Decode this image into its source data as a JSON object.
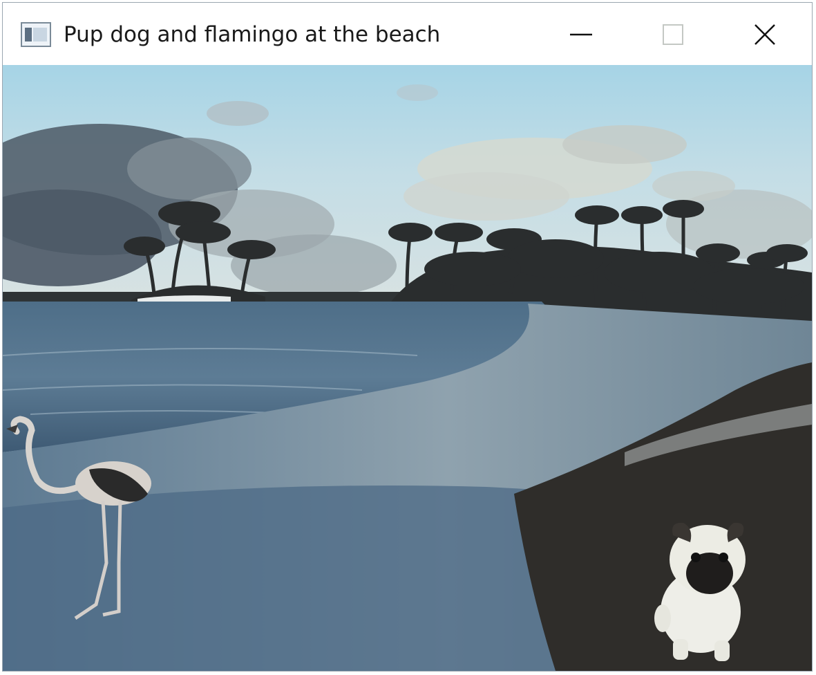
{
  "window": {
    "title": "Pup dog and flamingo at the beach"
  },
  "titlebar": {
    "app_icon": "app-window-icon",
    "controls": [
      {
        "name": "minimize",
        "icon": "minimize-icon"
      },
      {
        "name": "maximize",
        "icon": "maximize-icon"
      },
      {
        "name": "close",
        "icon": "close-icon"
      }
    ]
  },
  "scene": {
    "elements": [
      "sky",
      "clouds",
      "palm-trees",
      "ocean",
      "beach",
      "flamingo",
      "pug"
    ]
  },
  "colors": {
    "titlebar_bg": "#ffffff",
    "sky": "#a9d3e4",
    "water": "#4a6a86",
    "sand_dark": "#2c2a28"
  }
}
